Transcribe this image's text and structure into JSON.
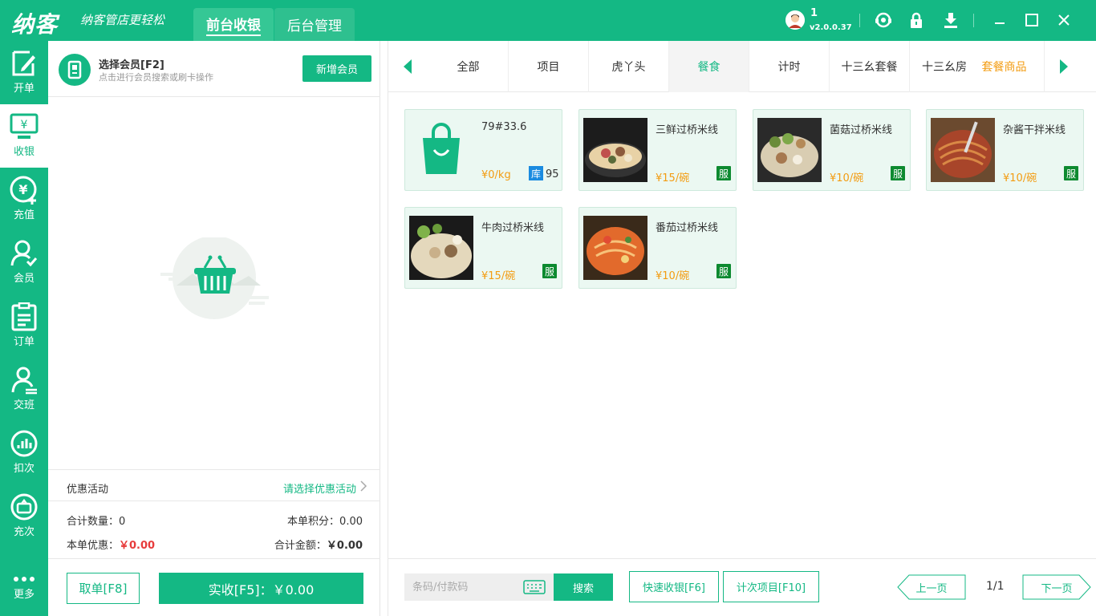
{
  "header": {
    "logo": "纳客",
    "slogan": "纳客管店更轻松",
    "tabs": [
      {
        "label": "前台收银"
      },
      {
        "label": "后台管理"
      }
    ],
    "user": "1",
    "version": "v2.0.0.37"
  },
  "nav": [
    {
      "label": "开单",
      "icon": "edit-icon"
    },
    {
      "label": "收银",
      "icon": "cashier-icon"
    },
    {
      "label": "充值",
      "icon": "recharge-icon"
    },
    {
      "label": "会员",
      "icon": "member-icon"
    },
    {
      "label": "订单",
      "icon": "order-icon"
    },
    {
      "label": "交班",
      "icon": "shift-icon"
    },
    {
      "label": "扣次",
      "icon": "deduct-icon"
    },
    {
      "label": "充次",
      "icon": "recharge-count-icon"
    },
    {
      "label": "更多",
      "icon": "more-icon"
    }
  ],
  "member": {
    "title": "选择会员[F2]",
    "subtitle": "点击进行会员搜索或刷卡操作",
    "add_button": "新增会员"
  },
  "promo": {
    "label": "优惠活动",
    "link": "请选择优惠活动"
  },
  "summary": {
    "qty_label": "合计数量：",
    "qty_value": "0",
    "points_label": "本单积分：",
    "points_value": "0.00",
    "discount_label": "本单优惠：",
    "discount_value": "￥0.00",
    "total_label": "合计金额：",
    "total_value": "￥0.00"
  },
  "actions": {
    "cancel": "取单[F8]",
    "pay": "实收[F5]：￥0.00"
  },
  "categories": [
    {
      "label": "全部"
    },
    {
      "label": "项目"
    },
    {
      "label": "虎丫头"
    },
    {
      "label": "餐食"
    },
    {
      "label": "计时"
    },
    {
      "label": "十三幺套餐"
    },
    {
      "label": "十三幺房"
    },
    {
      "label": "套餐商品"
    }
  ],
  "products": [
    {
      "name": "79#33.6",
      "price": "¥0/kg",
      "stock_badge": "库",
      "stock": "95"
    },
    {
      "name": "三鲜过桥米线",
      "price": "¥15/碗",
      "badge": "服"
    },
    {
      "name": "菌菇过桥米线",
      "price": "¥10/碗",
      "badge": "服"
    },
    {
      "name": "杂酱干拌米线",
      "price": "¥10/碗",
      "badge": "服"
    },
    {
      "name": "牛肉过桥米线",
      "price": "¥15/碗",
      "badge": "服"
    },
    {
      "name": "番茄过桥米线",
      "price": "¥10/碗",
      "badge": "服"
    }
  ],
  "footer": {
    "search_placeholder": "条码/付款码",
    "search_button": "搜索",
    "quick_pay": "快速收银[F6]",
    "count_item": "计次项目[F10]",
    "prev": "上一页",
    "page": "1/1",
    "next": "下一页"
  },
  "colors": {
    "primary": "#14b884",
    "price": "#f39c12",
    "discount": "#e73b3b"
  }
}
